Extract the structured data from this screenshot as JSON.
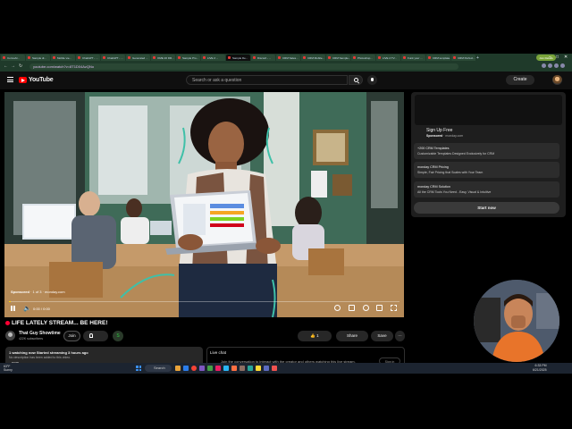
{
  "browser": {
    "tabs": [
      "ConvoAI...",
      "Sample di...",
      "Mobile vie...",
      "ChatGPT - ...",
      "ChatGPT - ...",
      "Generated ...",
      "OME 20 DR...",
      "Sample Pro...",
      "LIVE 2 ...",
      "Sample De...",
      "Discord - ...",
      "CRM Sales...",
      "CRM Mobile...",
      "CRM Sample...",
      "Photoshop...",
      "LIVE 2 TV...",
      "Funk your ...",
      "CRM template...",
      "CRM Perfect..."
    ],
    "active_tab_index": 9,
    "profile_label": "Join Details",
    "url": "youtube.com/watch?v=8T1D04AzQNo"
  },
  "header": {
    "logo_text": "YouTube",
    "search_placeholder": "Search or ask a question",
    "create_label": "Create"
  },
  "player": {
    "ad_label_sponsored": "Sponsored",
    "ad_label_rest": " · 1 of 3 · monday.com",
    "time": "0:00 / 0:00",
    "progress_fraction": 0.005
  },
  "video": {
    "title": "LIFE LATELY STREAM... BE HERE!",
    "channel_name": "That Guy Showtime",
    "subscribers": "422K subscribers",
    "join_label": "Join",
    "sub_badge": "S",
    "like_count": "1",
    "share_label": "Share",
    "save_label": "Save",
    "more_label": "···"
  },
  "description": {
    "line1": "1 watching now  Started streaming 3 hours ago",
    "line2": "No description has been added to this video.",
    "more": "...more"
  },
  "chat": {
    "title": "Live chat",
    "message": "Join the conversation to interact with the creator and others watching this live stream.",
    "signin_label": "Sign in"
  },
  "ad_panel": {
    "title": "Sign Up Free",
    "sponsored": "Sponsored",
    "advertiser": "monday.com",
    "rows": [
      {
        "a": "+200 CRM Templates",
        "b": "Customizable Templates Designed Exclusively for CRM"
      },
      {
        "a": "monday CRM Pricing",
        "b": "Simple, Fair Pricing that Scales with Your Team"
      },
      {
        "a": "monday CRM Solution",
        "b": "All the CRM Tools You Need - Easy, Visual & Intuitive"
      }
    ],
    "cta": "Start now"
  },
  "taskbar": {
    "search_label": "Search",
    "time": "6:33 PM",
    "date": "6/21/2025",
    "weather": "63°F\nSunny"
  },
  "colors": {
    "yt_red": "#ff0000",
    "live_red": "#ff0033",
    "browser_green": "#1f3a2a",
    "progress_yellow": "#ffd600"
  }
}
